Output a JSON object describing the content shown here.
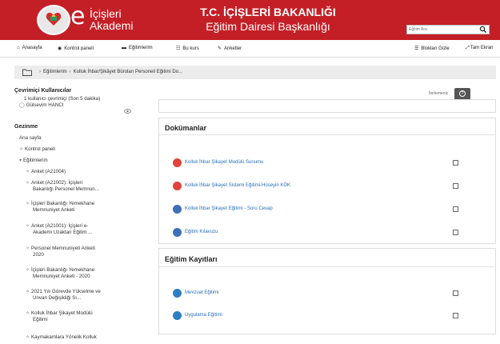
{
  "header": {
    "logo_e": "e",
    "logo_line1": "İçişleri",
    "logo_line2": "Akademi",
    "title_line1": "T.C. İÇİŞLERİ BAKANLIĞI",
    "title_line2": "Eğitim Dairesi Başkanlığı",
    "search_placeholder": "Eğitim Ara",
    "brand_color": "#c41f26"
  },
  "nav": {
    "items": [
      {
        "label": "Anasayfa",
        "icon": "home-icon"
      },
      {
        "label": "Kontrol paneli",
        "icon": "dashboard-icon"
      },
      {
        "label": "Eğitimlerim",
        "icon": "courses-icon"
      },
      {
        "label": "Bu kurs",
        "icon": "sitemap-icon"
      },
      {
        "label": "Anketler",
        "icon": "edit-icon"
      }
    ],
    "right_label": "Blokları Gizle",
    "fullscreen_label": "Tam Ekran"
  },
  "breadcrumb": {
    "items": [
      "Eğitimlerim",
      "Kolluk İhbar/Şikâyet Büroları Personeli Eğitimi Do..."
    ]
  },
  "online": {
    "title": "Çevrimiçi Kullanıcılar",
    "summary": "1 kullanıcı çevrimiçi (Son 5 dakika)",
    "user": "Gülsevim HANCI"
  },
  "gezinme": {
    "title": "Gezinme",
    "home": "Ana sayfa",
    "dashboard": "Kontrol paneli",
    "courses": "Eğitimlerim",
    "items": [
      [
        "Anket (A21004)"
      ],
      [
        "Anket (A21002): İçişleri",
        "Bakanlığı Personel Memnun..."
      ],
      [
        "İçişleri Bakanlığı Yemekhane",
        "Memnuniyet Anketi"
      ],
      [
        "Anket (A21001): İçişleri e-",
        "Akademi Uzaktan Eğitim ..."
      ],
      [
        "Personel Memnuniyeti Anketi",
        "2020"
      ],
      [
        "İçişleri Bakanlığı Yemekhane",
        "Memnuniyet Anketi - 2020"
      ],
      [
        "2021 Yılı Görevde Yükselme ve",
        "Unvan Değişikliği Sı..."
      ],
      [
        "Kolluk İhbar Şikayet Modülü",
        "Eğitimi"
      ],
      [
        "Kaymakamlara Yönelik Kolluk"
      ]
    ]
  },
  "progress": {
    "label": "İlerlemeniz",
    "help_icon": "question-icon"
  },
  "sections": [
    {
      "title": "Dokümanlar",
      "activities": [
        {
          "label": "Kolluk İhbar Şikayet Modülü Sunumu",
          "icon": "pdf-icon",
          "color": "#e0443a"
        },
        {
          "label": "Kolluk İhbar Şikayet Sistemi Eğitimi-Hüseyin KÖK",
          "icon": "pdf-icon",
          "color": "#e0443a"
        },
        {
          "label": "Kolluk İhbar Şikayet Eğitimi - Soru Cevap",
          "icon": "document-icon",
          "color": "#3d6fb6"
        },
        {
          "label": "Eğitim Kılavuzu",
          "icon": "document-icon",
          "color": "#3d6fb6"
        }
      ]
    },
    {
      "title": "Eğitim Kayıtları",
      "activities": [
        {
          "label": "Mevzuat Eğitimi",
          "icon": "video-icon",
          "color": "#2f7fc1"
        },
        {
          "label": "Uygulama Eğitimi",
          "icon": "video-icon",
          "color": "#2f7fc1"
        }
      ]
    }
  ]
}
